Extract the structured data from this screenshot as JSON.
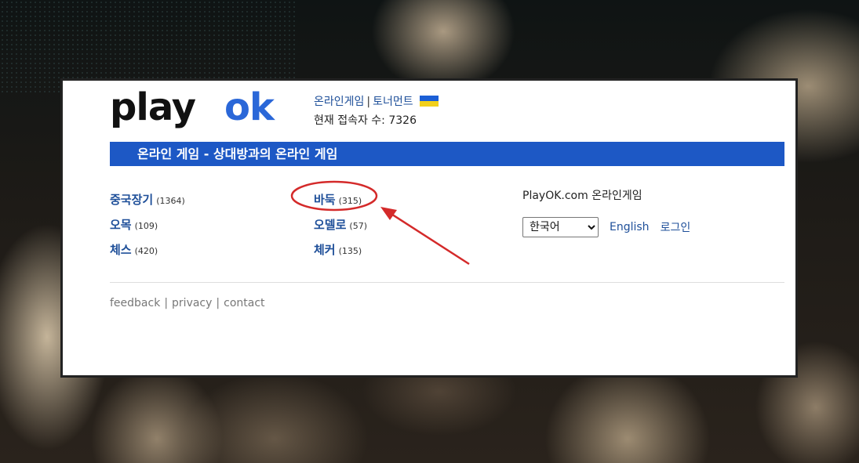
{
  "brand": {
    "logo_part1": "play",
    "logo_part2": "ok",
    "logo_color_dark": "#111111",
    "logo_color_accent": "#2a67d8"
  },
  "header": {
    "nav_games": "온라인게임",
    "separator": "|",
    "nav_tournament": "토너먼트",
    "flag_icon": "ukraine-flag-icon",
    "online_label": "현재 접속자 수: 7326"
  },
  "banner": {
    "title": "온라인 게임 - 상대방과의 온라인 게임",
    "color": "#1d58c5"
  },
  "games": {
    "column1": [
      {
        "name": "중국장기",
        "count": "(1364)"
      },
      {
        "name": "오목",
        "count": "(109)"
      },
      {
        "name": "체스",
        "count": "(420)"
      }
    ],
    "column2": [
      {
        "name": "바둑",
        "count": "(315)"
      },
      {
        "name": "오델로",
        "count": "(57)"
      },
      {
        "name": "체커",
        "count": "(135)"
      }
    ]
  },
  "side": {
    "about": "PlayOK.com 온라인게임",
    "language_selected": "한국어",
    "english_link": "English",
    "login_link": "로그인"
  },
  "footer": {
    "feedback": "feedback",
    "privacy": "privacy",
    "contact": "contact",
    "separator": "|"
  },
  "annotation": {
    "highlight_color": "#d42a2a"
  }
}
